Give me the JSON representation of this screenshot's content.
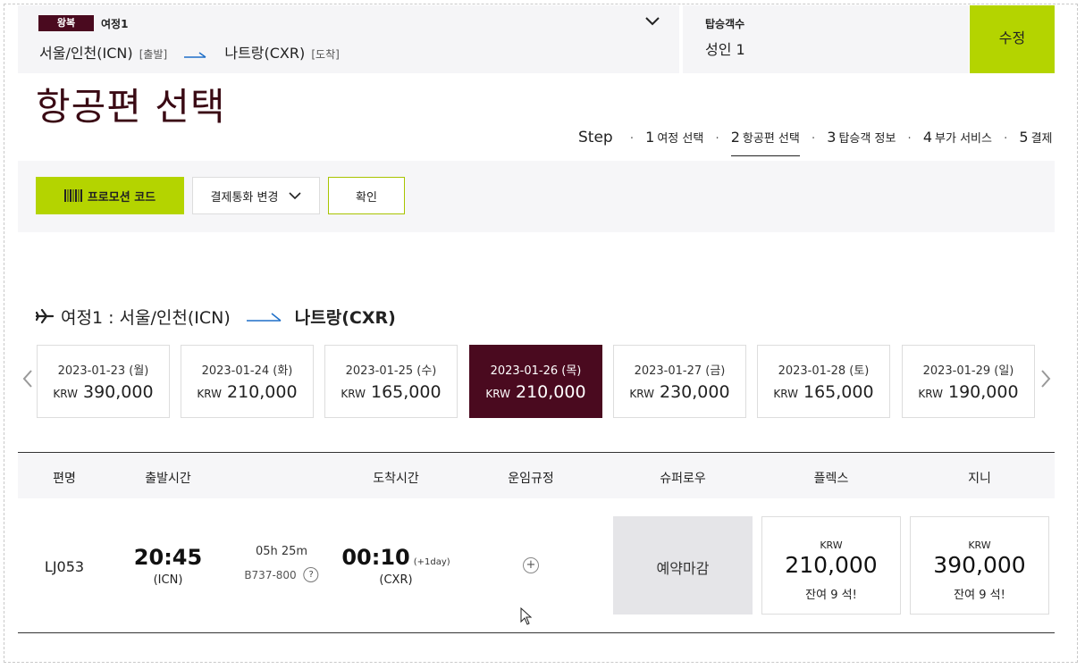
{
  "booking_bar": {
    "trip_type": "왕복",
    "trip_label": "여정1",
    "origin": "서울/인천(ICN)",
    "origin_tag": "[출발]",
    "destination": "나트랑(CXR)",
    "destination_tag": "[도착]",
    "pax_label": "탑승객수",
    "pax_value": "성인 1",
    "edit_label": "수정"
  },
  "page_title": "항공편 선택",
  "steps": {
    "title": "Step",
    "items": [
      {
        "num": "1",
        "label": "여정 선택"
      },
      {
        "num": "2",
        "label": "항공편 선택"
      },
      {
        "num": "3",
        "label": "탑승객 정보"
      },
      {
        "num": "4",
        "label": "부가 서비스"
      },
      {
        "num": "5",
        "label": "결제"
      }
    ],
    "active_index": 1
  },
  "promo": {
    "promo_label": "프로모션 코드",
    "currency_label": "결제통화 변경",
    "confirm_label": "확인"
  },
  "itinerary": {
    "prefix": "여정1 : 서울/인천(ICN)",
    "destination": "나트랑(CXR)"
  },
  "dates": [
    {
      "date": "2023-01-23 (월)",
      "currency": "KRW",
      "price": "390,000"
    },
    {
      "date": "2023-01-24 (화)",
      "currency": "KRW",
      "price": "210,000"
    },
    {
      "date": "2023-01-25 (수)",
      "currency": "KRW",
      "price": "165,000"
    },
    {
      "date": "2023-01-26 (목)",
      "currency": "KRW",
      "price": "210,000"
    },
    {
      "date": "2023-01-27 (금)",
      "currency": "KRW",
      "price": "230,000"
    },
    {
      "date": "2023-01-28 (토)",
      "currency": "KRW",
      "price": "165,000"
    },
    {
      "date": "2023-01-29 (일)",
      "currency": "KRW",
      "price": "190,000"
    }
  ],
  "selected_date_index": 3,
  "table": {
    "headers": {
      "flight": "편명",
      "departure": "출발시간",
      "arrival": "도착시간",
      "fare_rules": "운임규정",
      "super_low": "슈퍼로우",
      "flex": "플렉스",
      "genie": "지니"
    },
    "rows": [
      {
        "flight_no": "LJ053",
        "dep_time": "20:45",
        "dep_airport": "(ICN)",
        "duration": "05h 25m",
        "aircraft": "B737-800",
        "help": "?",
        "arr_time": "00:10",
        "plus_day": "(+1day)",
        "arr_airport": "(CXR)",
        "fare_plus": "+",
        "super_low": "예약마감",
        "flex": {
          "currency": "KRW",
          "amount": "210,000",
          "seats": "잔여 9 석!"
        },
        "genie": {
          "currency": "KRW",
          "amount": "390,000",
          "seats": "잔여 9 석!"
        }
      }
    ]
  },
  "colors": {
    "brand_dark": "#4a0a1f",
    "accent_green": "#b4d400",
    "arrow_blue": "#1e6fc8"
  }
}
